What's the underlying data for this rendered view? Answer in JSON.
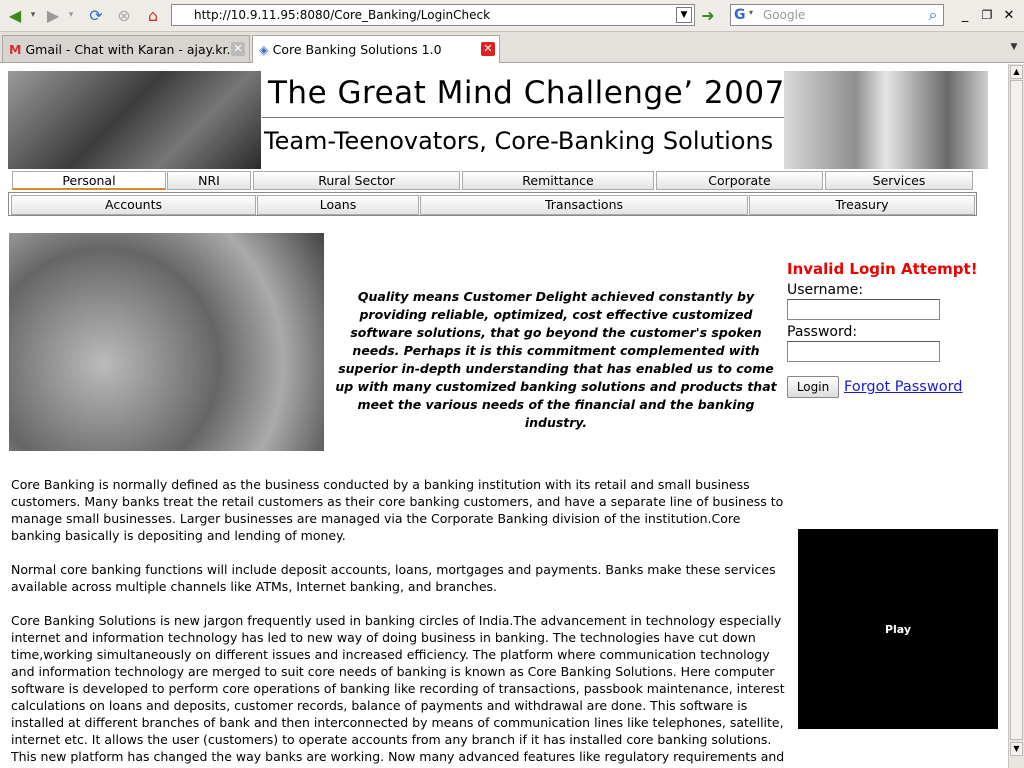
{
  "browser": {
    "url": "http://10.9.11.95:8080/Core_Banking/LoginCheck",
    "search_placeholder": "Google",
    "tabs": [
      {
        "label": "Gmail - Chat with Karan - ajay.kr...",
        "active": false
      },
      {
        "label": "Core Banking Solutions 1.0",
        "active": true
      }
    ]
  },
  "banner": {
    "title": "The Great Mind Challenge’ 2007",
    "subtitle": "Team-Teenovators, Core-Banking Solutions"
  },
  "nav_primary": [
    "Personal",
    "NRI",
    "Rural Sector",
    "Remittance",
    "Corporate",
    "Services"
  ],
  "nav_secondary": [
    "Accounts",
    "Loans",
    "Transactions",
    "Treasury"
  ],
  "quote": "Quality means Customer Delight achieved constantly by providing reliable, optimized, cost effective customized software solutions, that go beyond the customer's spoken needs. Perhaps it is this commitment complemented with superior in-depth understanding that has enabled us to come up with many customized banking solutions and products that meet the various needs of the financial and the banking industry.",
  "login": {
    "error": "Invalid Login Attempt!",
    "username_label": "Username:",
    "password_label": "Password:",
    "button": "Login",
    "forgot": "Forgot Password"
  },
  "body": {
    "p1": "Core Banking is normally defined as the business conducted by a banking institution with its retail and small business customers. Many banks treat the retail customers as their core banking customers, and have a separate line of business to manage small businesses. Larger businesses are managed via the Corporate Banking division of the institution.Core banking basically is depositing and lending of money.",
    "p2": "Normal core banking functions will include deposit accounts, loans, mortgages and payments. Banks make these services available across multiple channels like ATMs, Internet banking, and branches.",
    "p3": "Core Banking Solutions is new jargon frequently used in banking circles of India.The advancement in technology especially internet and information technology has led to new way of doing business in banking. The technologies have cut down time,working simultaneously on different issues and increased efficiency. The platform where communication technology and information technology are merged to suit core needs of banking is known as Core Banking Solutions. Here computer software is developed to perform core operations of banking like recording of transactions, passbook maintenance, interest calculations on loans and deposits, customer records, balance of payments and withdrawal are done. This software is installed at different branches of bank and then interconnected by means of communication lines like telephones, satellite, internet etc. It allows the user (customers) to operate accounts from any branch if it has installed core banking solutions. This new platform has changed the way banks are working. Now many advanced features like regulatory requirements and other specialised services like share (stock) trading are being provided.Core banking"
  },
  "video": {
    "play_label": "Play"
  },
  "icons": {
    "back": "back-arrow-icon",
    "forward": "forward-arrow-icon",
    "reload": "reload-icon",
    "stop": "stop-icon",
    "home": "home-icon",
    "go": "go-arrow-icon",
    "search": "magnifier-icon"
  }
}
